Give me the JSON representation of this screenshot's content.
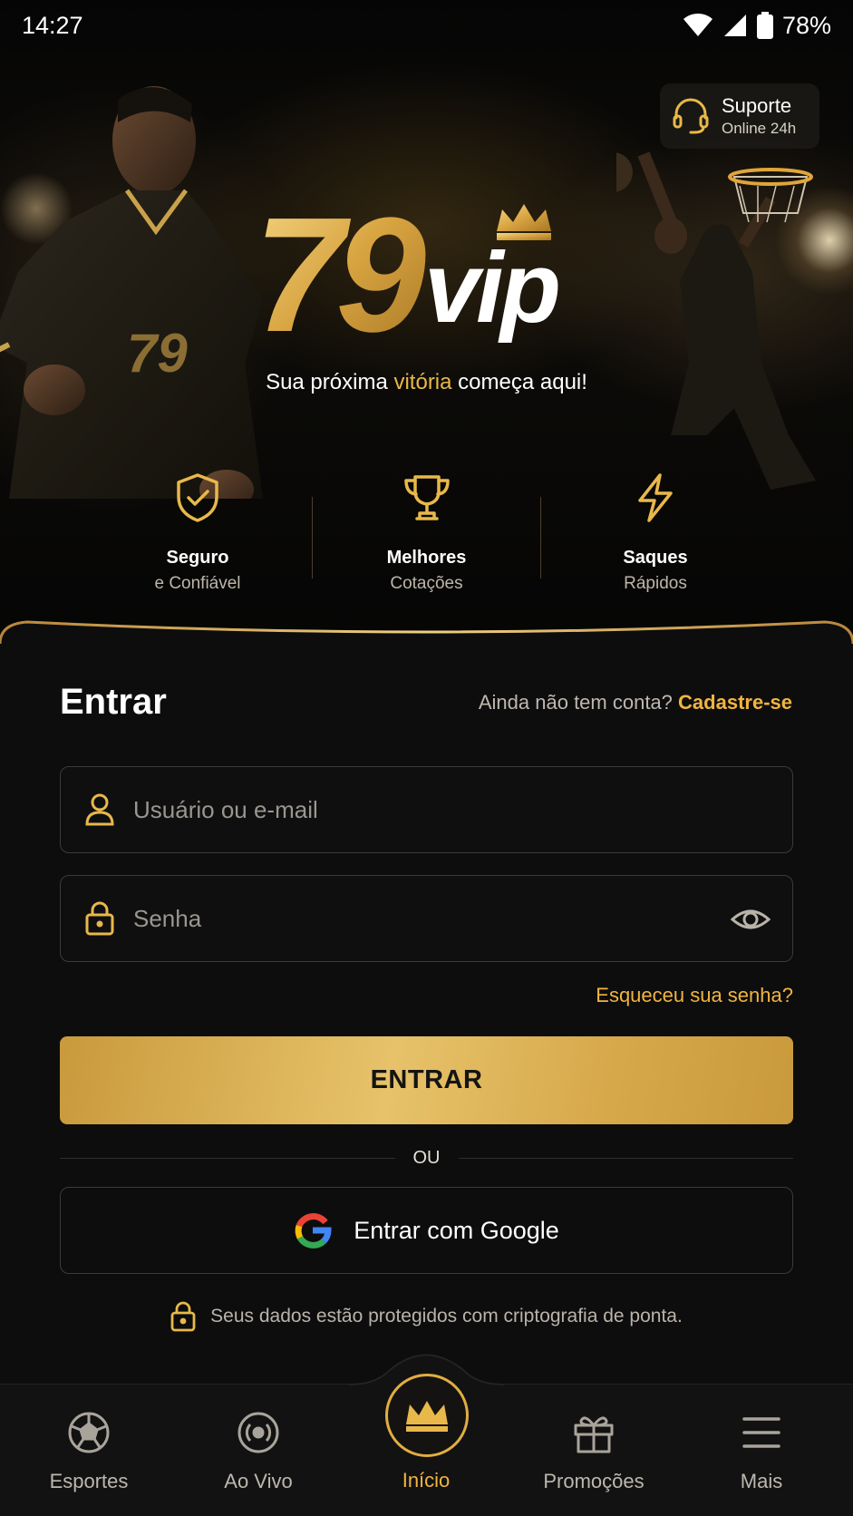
{
  "status_bar": {
    "time": "14:27",
    "battery": "78%",
    "icons": [
      "wifi-icon",
      "signal-icon",
      "battery-icon"
    ]
  },
  "support": {
    "title": "Suporte",
    "subtitle": "Online 24h",
    "icon": "headset-icon"
  },
  "brand": {
    "logo_number": "79",
    "logo_word": "vip",
    "accent_color": "#e8b84a"
  },
  "tagline": {
    "before": "Sua próxima ",
    "highlight": "vitória",
    "after": " começa aqui!"
  },
  "features": [
    {
      "icon": "shield-check-icon",
      "title": "Seguro",
      "subtitle": "e Confiável"
    },
    {
      "icon": "trophy-icon",
      "title": "Melhores",
      "subtitle": "Cotações"
    },
    {
      "icon": "lightning-icon",
      "title": "Saques",
      "subtitle": "Rápidos"
    }
  ],
  "login": {
    "title": "Entrar",
    "signup_prompt": "Ainda não tem conta?",
    "signup_link": "Cadastre-se",
    "username_placeholder": "Usuário ou e-mail",
    "username_value": "",
    "password_placeholder": "Senha",
    "password_value": "",
    "forgot_link": "Esqueceu sua senha?",
    "submit_label": "ENTRAR",
    "divider_text": "OU",
    "google_label": "Entrar com Google",
    "security_note": "Seus dados estão protegidos com criptografia de ponta."
  },
  "nav": {
    "items": [
      {
        "label": "Esportes",
        "icon": "soccer-ball-icon"
      },
      {
        "label": "Ao Vivo",
        "icon": "live-broadcast-icon"
      },
      {
        "label": "Início",
        "icon": "crown-icon",
        "active": true
      },
      {
        "label": "Promoções",
        "icon": "gift-icon"
      },
      {
        "label": "Mais",
        "icon": "menu-icon"
      }
    ]
  }
}
